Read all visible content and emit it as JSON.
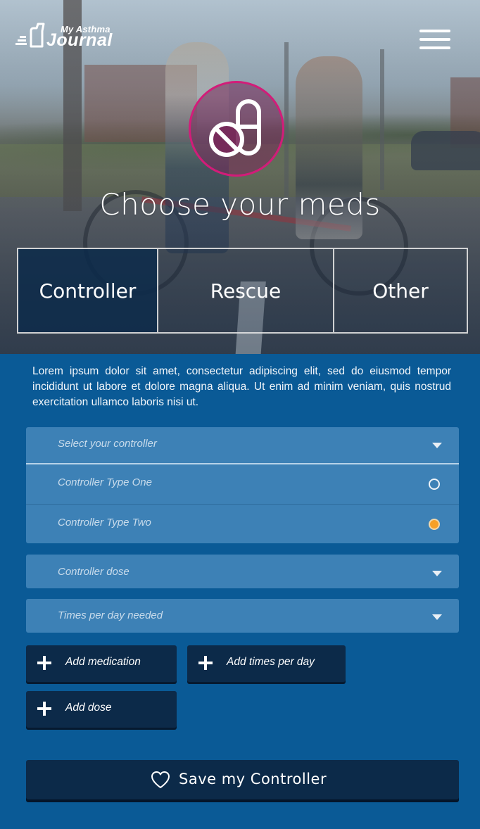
{
  "app": {
    "logo_small": "My Asthma",
    "logo_big": "Journal"
  },
  "header": {
    "menu_icon": "hamburger-menu-icon"
  },
  "hero": {
    "badge_icon": "pill-icon",
    "badge_color": "#d21c79",
    "title": "Choose your meds"
  },
  "tabs": [
    {
      "label": "Controller",
      "active": true
    },
    {
      "label": "Rescue",
      "active": false
    },
    {
      "label": "Other",
      "active": false
    }
  ],
  "intro_text": "Lorem ipsum dolor sit amet, consectetur adipiscing elit, sed do eiusmod tempor incididunt ut labore et dolore magna aliqua. Ut enim ad minim veniam, quis nostrud exercitation ullamco laboris nisi ut.",
  "controller_select": {
    "placeholder": "Select your controller",
    "options": [
      {
        "label": "Controller Type One",
        "selected": false
      },
      {
        "label": "Controller Type Two",
        "selected": true
      }
    ]
  },
  "dose_select": {
    "placeholder": "Controller dose"
  },
  "times_select": {
    "placeholder": "Times per day needed"
  },
  "actions": {
    "add_medication": "Add medication",
    "add_times": "Add times per day",
    "add_dose": "Add dose",
    "save": "Save my Controller"
  },
  "colors": {
    "background": "#0a5a96",
    "field": "#3d81b6",
    "button": "#0c2a49",
    "accent": "#d21c79",
    "radio_selected": "#f7a026"
  }
}
